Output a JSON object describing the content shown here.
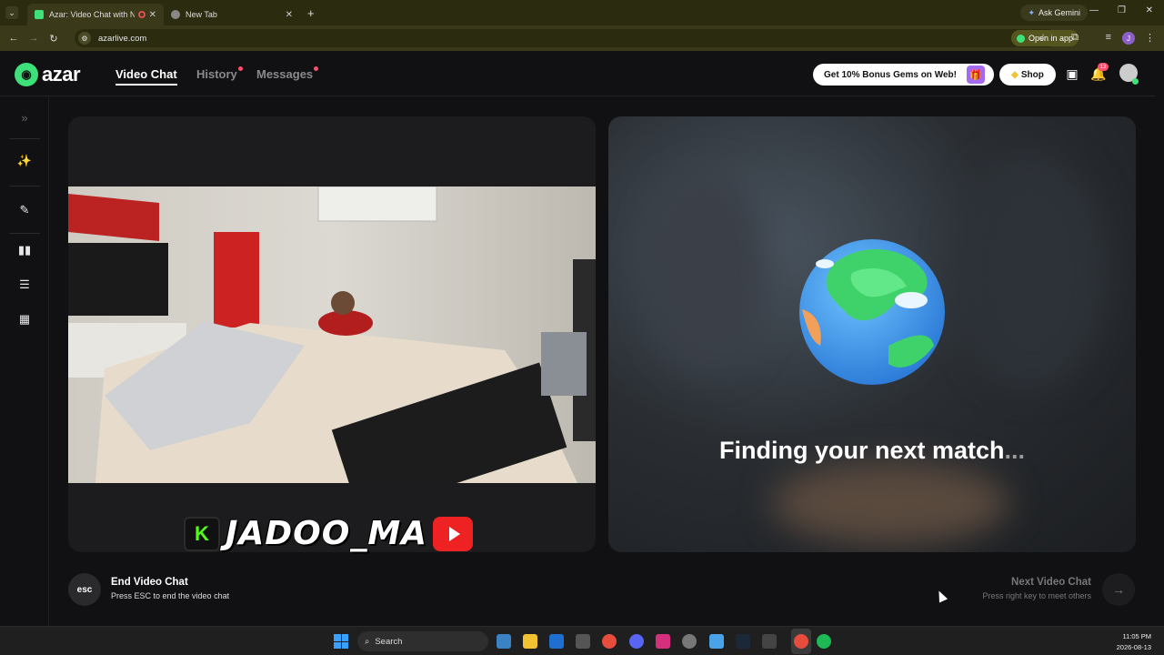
{
  "browser": {
    "tabs": [
      {
        "title": "Azar: Video Chat with New",
        "active": true
      },
      {
        "title": "New Tab",
        "active": false
      }
    ],
    "gemini_label": "Ask Gemini",
    "url": "azarlive.com",
    "open_in_app_label": "Open in app",
    "profile_initial": "J"
  },
  "app": {
    "logo_text": "azar",
    "nav": [
      {
        "label": "Video Chat",
        "active": true
      },
      {
        "label": "History",
        "dot": true
      },
      {
        "label": "Messages",
        "dot": true
      }
    ],
    "bonus_label": "Get 10% Bonus Gems on Web!",
    "shop_label": "Shop",
    "notification_count": "13"
  },
  "sidebar": {
    "icons": [
      "expand-icon",
      "magic-wand-icon",
      "edit-icon",
      "layout-side-by-side-icon",
      "layout-stacked-icon",
      "layout-grid-icon"
    ]
  },
  "video": {
    "watermark_text": "JADOO_MA",
    "finding_text": "Finding your next match",
    "finding_dots": "..."
  },
  "controls": {
    "esc_label": "esc",
    "end_title": "End Video Chat",
    "end_sub": "Press ESC to end the video chat",
    "next_title": "Next Video Chat",
    "next_sub": "Press right key to meet others"
  },
  "taskbar": {
    "search_label": "Search",
    "time": "11:05 PM",
    "date": "2026-08-13"
  },
  "colors": {
    "brand_green": "#3ee07a",
    "badge_red": "#ff4d6d",
    "chrome_bg": "#2b2b0f"
  }
}
